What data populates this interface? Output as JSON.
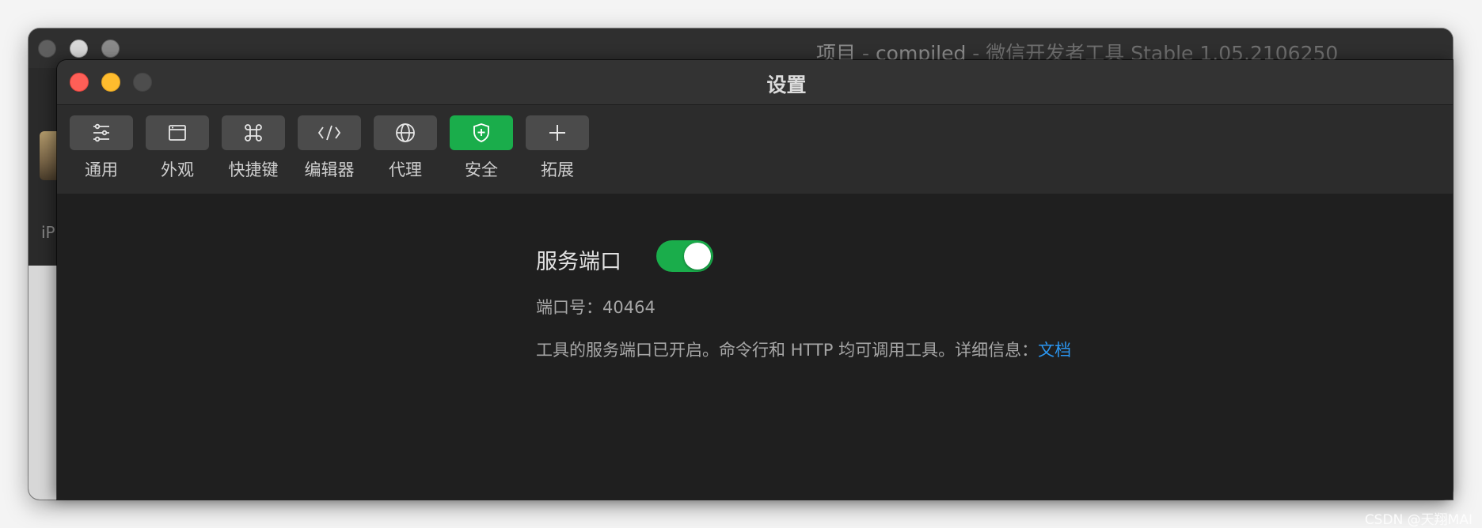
{
  "back_window": {
    "title_project": "项目",
    "title_sep1": " - ",
    "title_compiled": "compiled",
    "title_sep2": " - ",
    "title_app": "微信开发者工具 Stable 1.05.2106250",
    "side_text": "iP",
    "side_dots": "●●"
  },
  "settings": {
    "title": "设置",
    "tabs": [
      {
        "label": "通用",
        "icon": "sliders-icon",
        "active": false
      },
      {
        "label": "外观",
        "icon": "window-icon",
        "active": false
      },
      {
        "label": "快捷键",
        "icon": "command-icon",
        "active": false
      },
      {
        "label": "编辑器",
        "icon": "code-icon",
        "active": false
      },
      {
        "label": "代理",
        "icon": "globe-icon",
        "active": false
      },
      {
        "label": "安全",
        "icon": "shield-plus-icon",
        "active": true
      },
      {
        "label": "拓展",
        "icon": "plus-icon",
        "active": false
      }
    ],
    "service_port": {
      "label": "服务端口",
      "enabled": true,
      "port_label": "端口号：",
      "port_value": "40464",
      "info_text": "工具的服务端口已开启。命令行和 HTTP 均可调用工具。详细信息：",
      "doc_link": "文档"
    }
  },
  "colors": {
    "accent_green": "#1aad4b",
    "link_blue": "#2b96f0",
    "traffic_red": "#fe5f57",
    "traffic_yellow": "#febc2e"
  },
  "watermark": "CSDN @天翔MAI"
}
